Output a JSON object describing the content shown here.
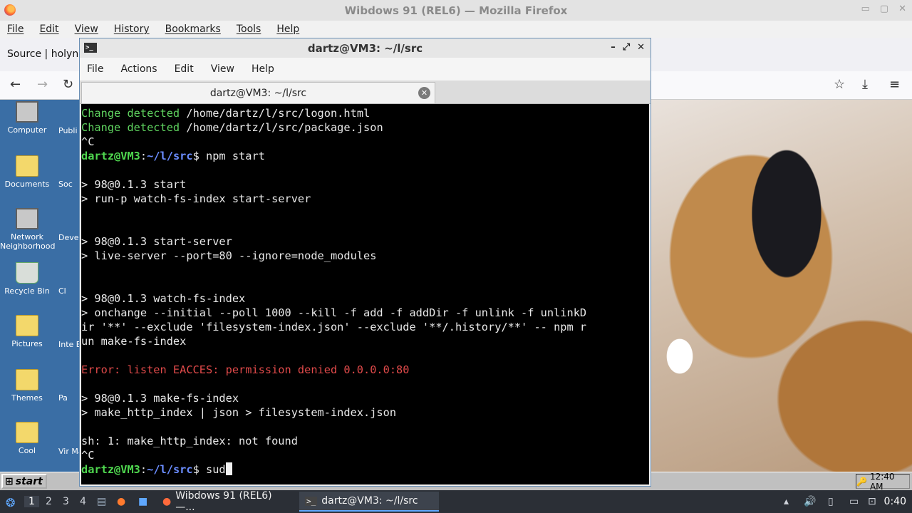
{
  "firefox": {
    "title": "Wibdows 91 (REL6) — Mozilla Firefox",
    "menu": [
      "File",
      "Edit",
      "View",
      "History",
      "Bookmarks",
      "Tools",
      "Help"
    ],
    "tab_text": "Source | holyne"
  },
  "desktop": {
    "icons": [
      "Computer",
      "Documents",
      "Network Neighborhood",
      "Recycle Bin",
      "Pictures",
      "Themes",
      "Cool"
    ],
    "icons_col2": [
      "Publi",
      "Soc",
      "Deve Ins",
      "Cl",
      "Inte Exp",
      "Pa",
      "Vir Mac"
    ]
  },
  "w9x_taskbar": {
    "start_label": "start",
    "clock": "12:40 AM"
  },
  "host_taskbar": {
    "workspaces": [
      "1",
      "2",
      "3",
      "4"
    ],
    "tasks": [
      "Wibdows 91 (REL6) —...",
      "dartz@VM3: ~/l/src"
    ],
    "clock": "0:40"
  },
  "terminal": {
    "title": "dartz@VM3: ~/l/src",
    "menu": [
      "File",
      "Actions",
      "Edit",
      "View",
      "Help"
    ],
    "tab_label": "dartz@VM3: ~/l/src",
    "lines": {
      "l1a": "Change detected",
      "l1b": " /home/dartz/l/src/logon.html",
      "l2a": "Change detected",
      "l2b": " /home/dartz/l/src/package.json",
      "l3": "^C",
      "p1_user": "dartz@VM3",
      "p1_colon": ":",
      "p1_path": "~/l/src",
      "p1_cmd": "$ npm start",
      "l5": "",
      "l6": "> 98@0.1.3 start",
      "l7": "> run-p watch-fs-index start-server",
      "l10": "> 98@0.1.3 start-server",
      "l11": "> live-server --port=80 --ignore=node_modules",
      "l14": "> 98@0.1.3 watch-fs-index",
      "l15": "> onchange --initial --poll 1000 --kill -f add -f addDir -f unlink -f unlinkD",
      "l16": "ir '**' --exclude 'filesystem-index.json' --exclude '**/.history/**' -- npm r",
      "l17": "un make-fs-index",
      "l19": "Error: listen EACCES: permission denied 0.0.0.0:80",
      "l21": "> 98@0.1.3 make-fs-index",
      "l22": "> make_http_index | json > filesystem-index.json",
      "l24": "sh: 1: make_http_index: not found",
      "l25": "^C",
      "p2_user": "dartz@VM3",
      "p2_colon": ":",
      "p2_path": "~/l/src",
      "p2_cmd": "$ sud"
    }
  }
}
